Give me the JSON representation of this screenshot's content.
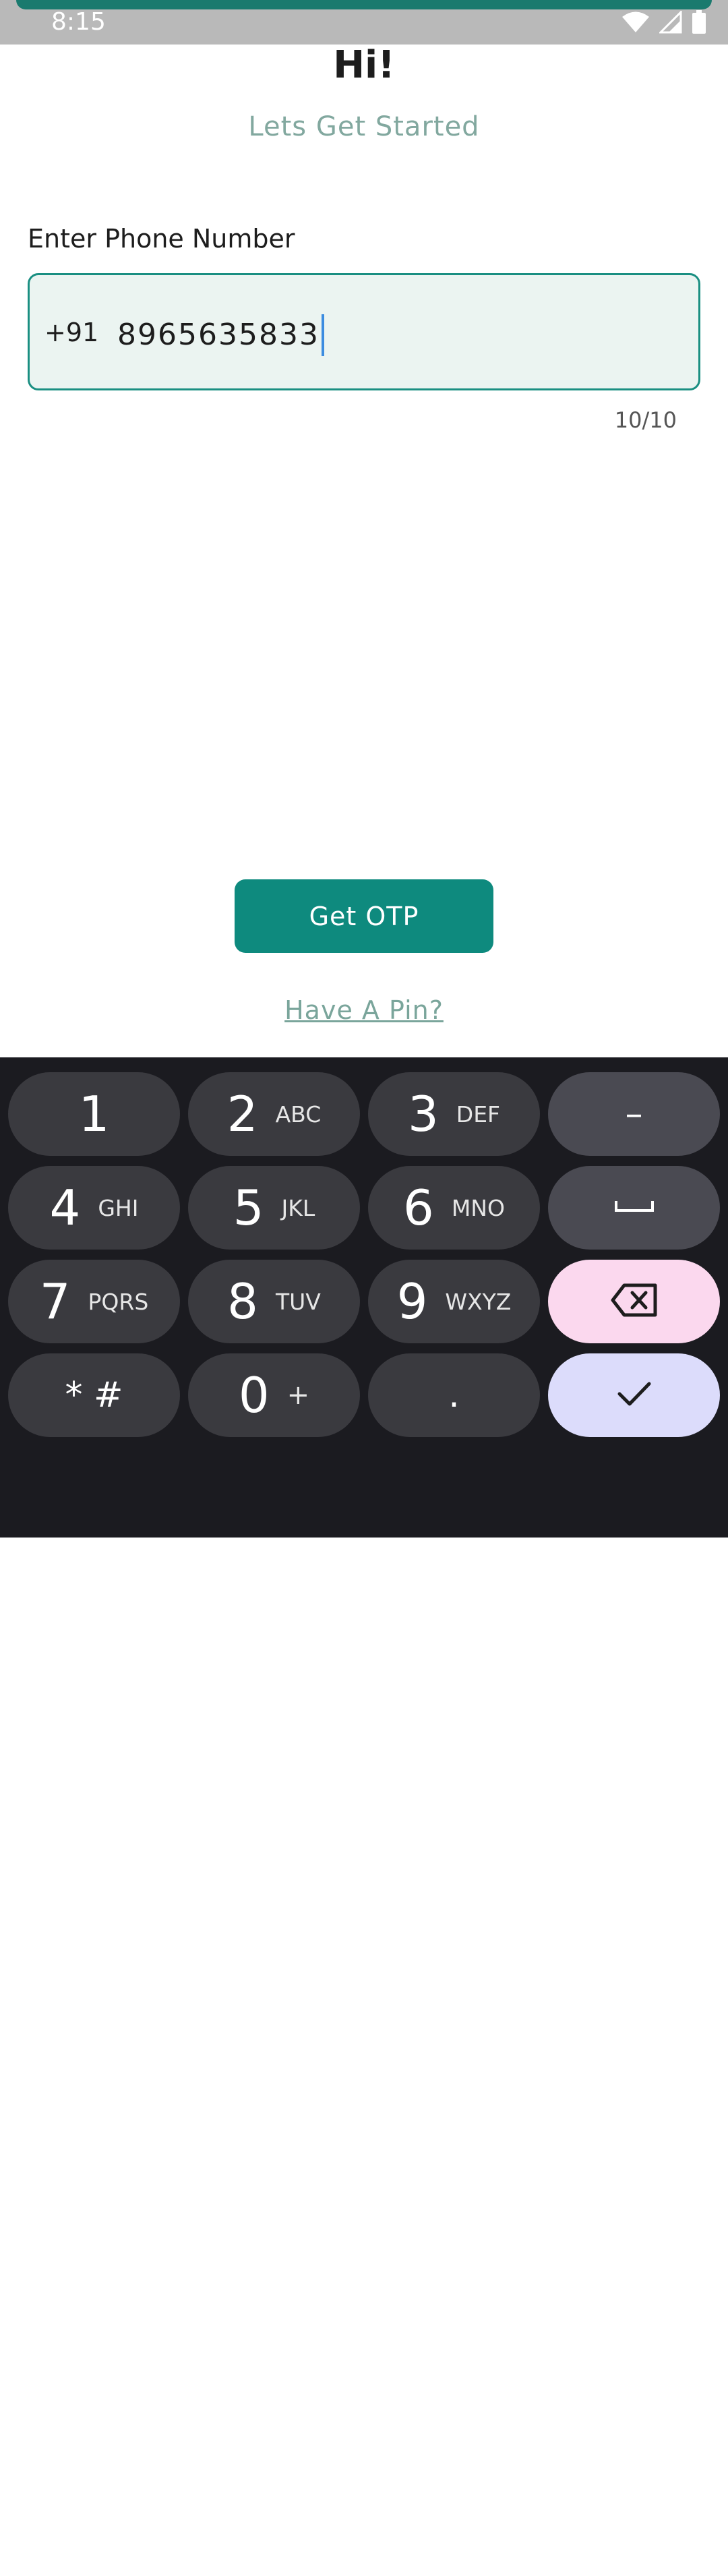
{
  "status_bar": {
    "time": "8:15"
  },
  "header": {
    "title": "Hi!",
    "subtitle": "Lets Get Started"
  },
  "phone": {
    "label": "Enter Phone Number",
    "country_code": "+91",
    "value": "8965635833",
    "counter": "10/10"
  },
  "actions": {
    "get_otp": "Get OTP",
    "have_pin": "Have A Pin?"
  },
  "keyboard": {
    "keys": [
      {
        "digit": "1",
        "letters": ""
      },
      {
        "digit": "2",
        "letters": "ABC"
      },
      {
        "digit": "3",
        "letters": "DEF"
      },
      {
        "digit": "4",
        "letters": "GHI"
      },
      {
        "digit": "5",
        "letters": "JKL"
      },
      {
        "digit": "6",
        "letters": "MNO"
      },
      {
        "digit": "7",
        "letters": "PQRS"
      },
      {
        "digit": "8",
        "letters": "TUV"
      },
      {
        "digit": "9",
        "letters": "WXYZ"
      }
    ],
    "star_hash": "* #",
    "zero": "0",
    "plus": "+",
    "period": ".",
    "dash": "–"
  },
  "colors": {
    "accent": "#0e8a7e",
    "field_background": "#ebf4f1",
    "subtitle": "#82a89f",
    "keyboard_background": "#1b1b20",
    "delete_key": "#fbd8ee",
    "done_key": "#dcdcfb"
  },
  "icons": {
    "status": [
      "wifi-icon",
      "signal-icon",
      "battery-icon"
    ],
    "keyboard": [
      "space-icon",
      "backspace-icon",
      "check-icon",
      "chevron-down-icon",
      "keyboard-icon"
    ]
  }
}
